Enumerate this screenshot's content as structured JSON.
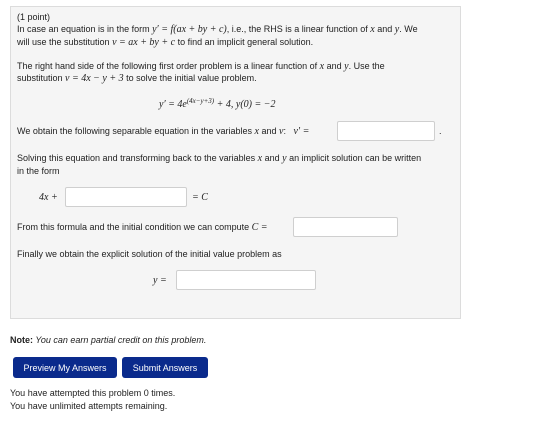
{
  "problem": {
    "points": "(1 point)",
    "intro_line1_a": "In case an equation is in the form ",
    "intro_eq": "y′ = f(ax + by + c)",
    "intro_line1_b": ", i.e., the RHS is a linear function of ",
    "var_x": "x",
    "and": " and ",
    "var_y": "y",
    "intro_line1_c": ". We",
    "intro_line2_a": "will use the substitution ",
    "intro_sub": "v = ax + by + c",
    "intro_line2_b": " to find an implicit general solution.",
    "rhs_line1_a": "The right hand side of the following first order problem is a linear function of ",
    "rhs_line1_b": " and ",
    "rhs_line1_c": ". Use the",
    "rhs_line2_a": "substitution ",
    "rhs_sub": "v = 4x − y + 3",
    "rhs_line2_b": " to solve the initial value problem.",
    "ivp_lhs": "y′ = 4e",
    "ivp_exp": "(4x−y+3)",
    "ivp_rhs": " + 4,   y(0) = −2",
    "separable_a": "We obtain the following separable equation in the variables ",
    "separable_b": " and ",
    "separable_v": "v",
    "separable_c": ":",
    "separable_eq": "v′ =",
    "separable_end": ".",
    "solving_line1": "Solving this equation and transforming back to the variables ",
    "solving_line1_b": " and ",
    "solving_line1_c": " an implicit solution can be written",
    "solving_line2": "in the form",
    "implicit_lhs": "4x +",
    "implicit_rhs": "= C",
    "compute_c": "From this formula and the initial condition we can compute ",
    "compute_c_eq": "C =",
    "explicit": "Finally we obtain the explicit solution of the initial value problem as",
    "explicit_eq": "y ="
  },
  "note": {
    "label": "Note:",
    "text": " You can earn partial credit on this problem."
  },
  "buttons": {
    "preview": "Preview My Answers",
    "submit": "Submit Answers"
  },
  "attempts": {
    "line1": "You have attempted this problem 0 times.",
    "line2": "You have unlimited attempts remaining."
  }
}
